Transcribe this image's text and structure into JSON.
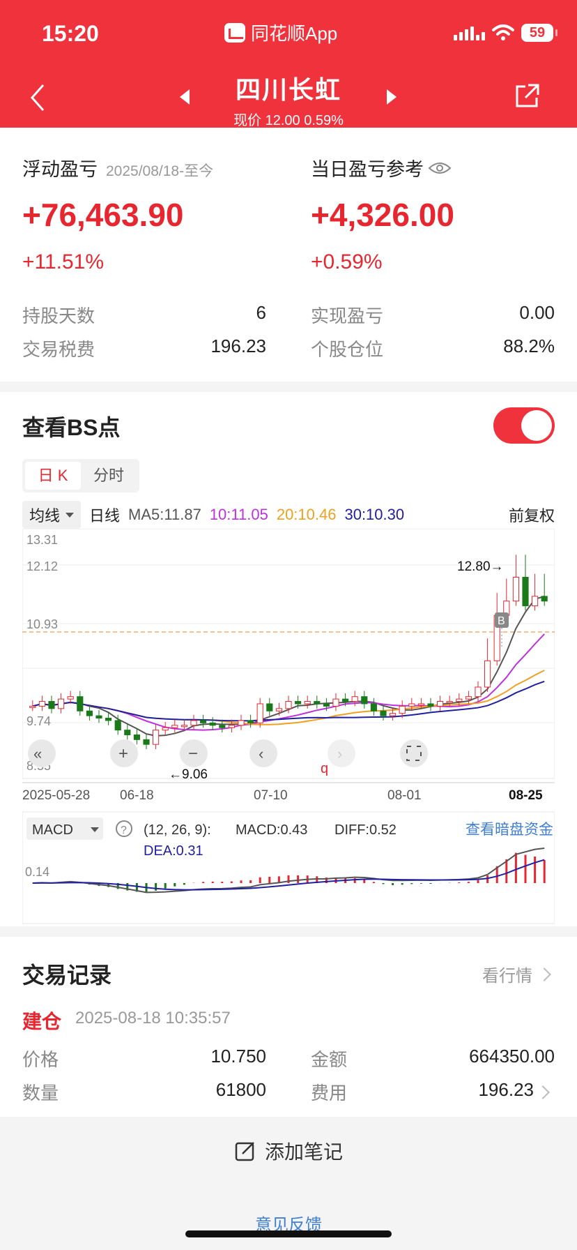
{
  "status": {
    "time": "15:20",
    "app_name": "同花顺App",
    "battery": "59"
  },
  "header": {
    "title": "四川长虹",
    "subtitle": "现价 12.00 0.59%"
  },
  "pnl": {
    "floating_label": "浮动盈亏",
    "floating_since": "2025/08/18-至今",
    "floating_value": "+76,463.90",
    "floating_pct": "+11.51%",
    "daily_label": "当日盈亏参考",
    "daily_value": "+4,326.00",
    "daily_pct": "+0.59%",
    "stats": [
      {
        "label": "持股天数",
        "value": "6"
      },
      {
        "label": "交易税费",
        "value": "196.23"
      },
      {
        "label": "实现盈亏",
        "value": "0.00"
      },
      {
        "label": "个股仓位",
        "value": "88.2%"
      }
    ]
  },
  "bs": {
    "title": "查看BS点",
    "toggle_on": true,
    "tabs": [
      "日 K",
      "分时"
    ],
    "ma_select": "均线",
    "ma_period": "日线",
    "ma5": "MA5:11.87",
    "ma10": "10:11.05",
    "ma20": "20:10.46",
    "ma30": "30:10.30",
    "adjust": "前复权",
    "colors": {
      "ma5": "#555555",
      "ma10": "#c030e0",
      "ma20": "#f0a020",
      "ma30": "#2020a0",
      "up": "#e8262f",
      "down": "#1a7a1a"
    }
  },
  "chart_data": [
    {
      "type": "candlestick",
      "y_ticks": [
        "13.31",
        "12.12",
        "10.93",
        "9.74",
        "8.55"
      ],
      "ylim": [
        8.55,
        13.31
      ],
      "x_ticks": [
        "2025-05-28",
        "06-18",
        "07-10",
        "08-01",
        "08-25"
      ],
      "annotations": {
        "high": "12.80→",
        "low": "←9.06",
        "buy_marker": "B",
        "note_marker": "q"
      },
      "closes": [
        9.8,
        9.9,
        9.75,
        9.95,
        10.0,
        9.7,
        9.6,
        9.55,
        9.5,
        9.3,
        9.2,
        9.1,
        9.0,
        9.3,
        9.35,
        9.4,
        9.4,
        9.5,
        9.45,
        9.4,
        9.35,
        9.4,
        9.5,
        9.45,
        9.85,
        9.7,
        9.75,
        9.9,
        9.85,
        9.9,
        9.85,
        9.8,
        9.95,
        9.9,
        10.0,
        9.85,
        9.7,
        9.6,
        9.65,
        9.8,
        9.85,
        9.85,
        9.8,
        9.9,
        9.9,
        9.95,
        10.0,
        10.2,
        10.75,
        11.7,
        12.0,
        12.5,
        11.9,
        12.1,
        12.0
      ],
      "ma_lines": [
        "MA5",
        "MA10",
        "MA20",
        "MA30"
      ]
    },
    {
      "type": "bar",
      "name": "MACD",
      "params": "(12, 26, 9):",
      "macd": "MACD:0.43",
      "diff": "DIFF:0.52",
      "dea": "DEA:0.31",
      "y_tick": "0.14",
      "link": "查看暗盘资金"
    }
  ],
  "trades": {
    "title": "交易记录",
    "link": "看行情",
    "type": "建仓",
    "time": "2025-08-18 10:35:57",
    "rows": [
      {
        "label": "价格",
        "value": "10.750"
      },
      {
        "label": "数量",
        "value": "61800"
      },
      {
        "label": "金额",
        "value": "664350.00"
      },
      {
        "label": "费用",
        "value": "196.23"
      }
    ]
  },
  "footer": {
    "add_note": "添加笔记",
    "feedback": "意见反馈"
  }
}
